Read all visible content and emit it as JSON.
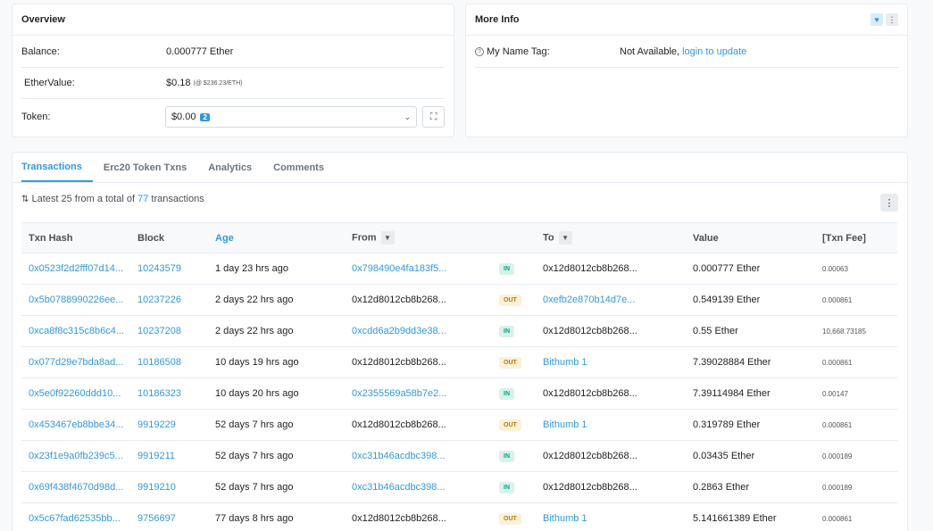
{
  "overview": {
    "title": "Overview",
    "balance_label": "Balance:",
    "balance_value": "0.000777 Ether",
    "ethervalue_label": "EtherValue:",
    "ethervalue_value": "$0.18",
    "ethervalue_rate": "(@ $236.23/ETH)",
    "token_label": "Token:",
    "token_value": "$0.00",
    "token_count": "2"
  },
  "more_info": {
    "title": "More Info",
    "name_tag_label": "My Name Tag:",
    "name_tag_value": "Not Available,",
    "name_tag_link": "login to update"
  },
  "tabs": [
    "Transactions",
    "Erc20 Token Txns",
    "Analytics",
    "Comments"
  ],
  "summary": {
    "prefix": "Latest 25 from a total of",
    "count": "77",
    "suffix": "transactions"
  },
  "table": {
    "headers": {
      "hash": "Txn Hash",
      "block": "Block",
      "age": "Age",
      "from": "From",
      "to": "To",
      "value": "Value",
      "fee": "[Txn Fee]"
    },
    "rows": [
      {
        "hash": "0x0523f2d2fff07d14...",
        "block": "10243579",
        "age": "1 day 23 hrs ago",
        "from": "0x798490e4fa183f5...",
        "from_link": true,
        "dir": "IN",
        "to": "0x12d8012cb8b268...",
        "to_link": false,
        "value": "0.000777 Ether",
        "fee": "0.00063"
      },
      {
        "hash": "0x5b0788990226ee...",
        "block": "10237226",
        "age": "2 days 22 hrs ago",
        "from": "0x12d8012cb8b268...",
        "from_link": false,
        "dir": "OUT",
        "to": "0xefb2e870b14d7e...",
        "to_link": true,
        "value": "0.549139 Ether",
        "fee": "0.000861"
      },
      {
        "hash": "0xca8f8c315c8b6c4...",
        "block": "10237208",
        "age": "2 days 22 hrs ago",
        "from": "0xcdd6a2b9dd3e38...",
        "from_link": true,
        "dir": "IN",
        "to": "0x12d8012cb8b268...",
        "to_link": false,
        "value": "0.55 Ether",
        "fee": "10,668.73185"
      },
      {
        "hash": "0x077d29e7bda8ad...",
        "block": "10186508",
        "age": "10 days 19 hrs ago",
        "from": "0x12d8012cb8b268...",
        "from_link": false,
        "dir": "OUT",
        "to": "Bithumb 1",
        "to_link": true,
        "value": "7.39028884 Ether",
        "fee": "0.000861"
      },
      {
        "hash": "0x5e0f92260ddd10...",
        "block": "10186323",
        "age": "10 days 20 hrs ago",
        "from": "0x2355569a58b7e2...",
        "from_link": true,
        "dir": "IN",
        "to": "0x12d8012cb8b268...",
        "to_link": false,
        "value": "7.39114984 Ether",
        "fee": "0.00147"
      },
      {
        "hash": "0x453467eb8bbe34...",
        "block": "9919229",
        "age": "52 days 7 hrs ago",
        "from": "0x12d8012cb8b268...",
        "from_link": false,
        "dir": "OUT",
        "to": "Bithumb 1",
        "to_link": true,
        "value": "0.319789 Ether",
        "fee": "0.000861"
      },
      {
        "hash": "0x23f1e9a0fb239c5...",
        "block": "9919211",
        "age": "52 days 7 hrs ago",
        "from": "0xc31b46acdbc398...",
        "from_link": true,
        "dir": "IN",
        "to": "0x12d8012cb8b268...",
        "to_link": false,
        "value": "0.03435 Ether",
        "fee": "0.000189"
      },
      {
        "hash": "0x69f438f4670d98d...",
        "block": "9919210",
        "age": "52 days 7 hrs ago",
        "from": "0xc31b46acdbc398...",
        "from_link": true,
        "dir": "IN",
        "to": "0x12d8012cb8b268...",
        "to_link": false,
        "value": "0.2863 Ether",
        "fee": "0.000189"
      },
      {
        "hash": "0x5c67fad62535bb...",
        "block": "9756697",
        "age": "77 days 8 hrs ago",
        "from": "0x12d8012cb8b268...",
        "from_link": false,
        "dir": "OUT",
        "to": "Bithumb 1",
        "to_link": true,
        "value": "5.141661389 Ether",
        "fee": "0.000861"
      }
    ]
  }
}
